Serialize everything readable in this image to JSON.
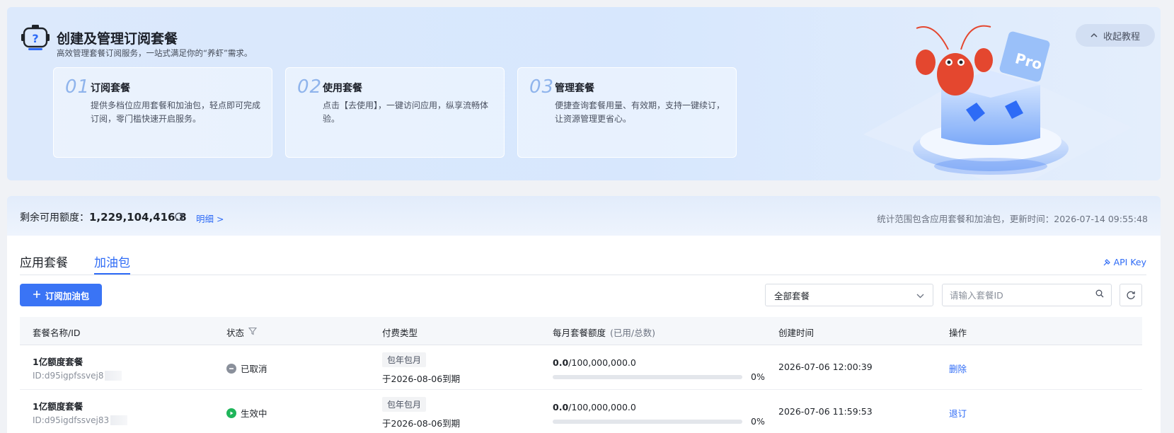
{
  "banner": {
    "title": "创建及管理订阅套餐",
    "subtitle": "高效管理套餐订阅服务，一站式满足你的“养虾”需求。",
    "collapse_label": "收起教程",
    "steps": [
      {
        "num": "01",
        "title": "订阅套餐",
        "desc": "提供多档位应用套餐和加油包，轻点即可完成订阅，零门槛快速开启服务。"
      },
      {
        "num": "02",
        "title": "使用套餐",
        "desc": "点击【去使用】，一键访问应用，纵享流畅体验。"
      },
      {
        "num": "03",
        "title": "管理套餐",
        "desc": "便捷查询套餐用量、有效期，支持一键续订，让资源管理更省心。"
      }
    ]
  },
  "quota": {
    "label": "剩余可用额度：",
    "value": "1,229,104,416.8",
    "detail_link": "明细 >",
    "note": "统计范围包含应用套餐和加油包，更新时间：2026-07-14 09:55:48"
  },
  "tabs": [
    {
      "label": "应用套餐",
      "active": false
    },
    {
      "label": "加油包",
      "active": true
    }
  ],
  "toolbar": {
    "api_key": "API Key",
    "subscribe_label": "订阅加油包",
    "select_value": "全部套餐",
    "search_placeholder": "请输入套餐ID"
  },
  "table": {
    "headers": {
      "name": "套餐名称/ID",
      "status": "状态",
      "pay_type": "付费类型",
      "quota": "每月套餐额度",
      "quota_hint": "(已用/总数)",
      "created": "创建时间",
      "action": "操作"
    },
    "rows": [
      {
        "name": "1亿额度套餐",
        "id": "ID:d95igpfssvej8",
        "status": "已取消",
        "status_color": "#8a909b",
        "pay_tag": "包年包月",
        "expire": "于2026-08-06到期",
        "used": "0.0",
        "total": "/100,000,000.0",
        "percent": 0,
        "percent_label": "0%",
        "created": "2026-07-06 12:00:39",
        "action": "删除"
      },
      {
        "name": "1亿额度套餐",
        "id": "ID:d95igdfssvej83",
        "status": "生效中",
        "status_color": "#1fb55a",
        "pay_tag": "包年包月",
        "expire": "于2026-08-06到期",
        "used": "0.0",
        "total": "/100,000,000.0",
        "percent": 0,
        "percent_label": "0%",
        "created": "2026-07-06 11:59:53",
        "action": "退订"
      }
    ]
  },
  "colors": {
    "accent": "#2e6bf6",
    "primary_button": "#3a74f5"
  }
}
